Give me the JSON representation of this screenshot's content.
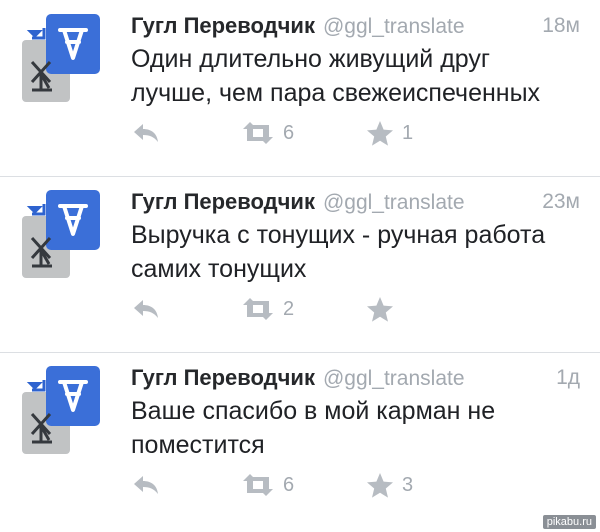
{
  "tweets": [
    {
      "name": "Гугл Переводчик",
      "handle": "@ggl_translate",
      "time": "18м",
      "text": "Один длительно живущий друг лучше, чем пара свежеиспеченных",
      "retweets": "6",
      "favorites": "1"
    },
    {
      "name": "Гугл Переводчик",
      "handle": "@ggl_translate",
      "time": "23м",
      "text": "Выручка с тонущих - ручная работа самих тонущих",
      "retweets": "2",
      "favorites": ""
    },
    {
      "name": "Гугл Переводчик",
      "handle": "@ggl_translate",
      "time": "1д",
      "text": "Ваше спасибо в мой карман не поместится",
      "retweets": "6",
      "favorites": "3"
    }
  ],
  "watermark": "pikabu.ru",
  "colors": {
    "avatar_blue": "#3b6fd8",
    "avatar_gray": "#c9cbcd",
    "icon_gray": "#b7bcc2",
    "muted_text": "#a3a9b0"
  }
}
